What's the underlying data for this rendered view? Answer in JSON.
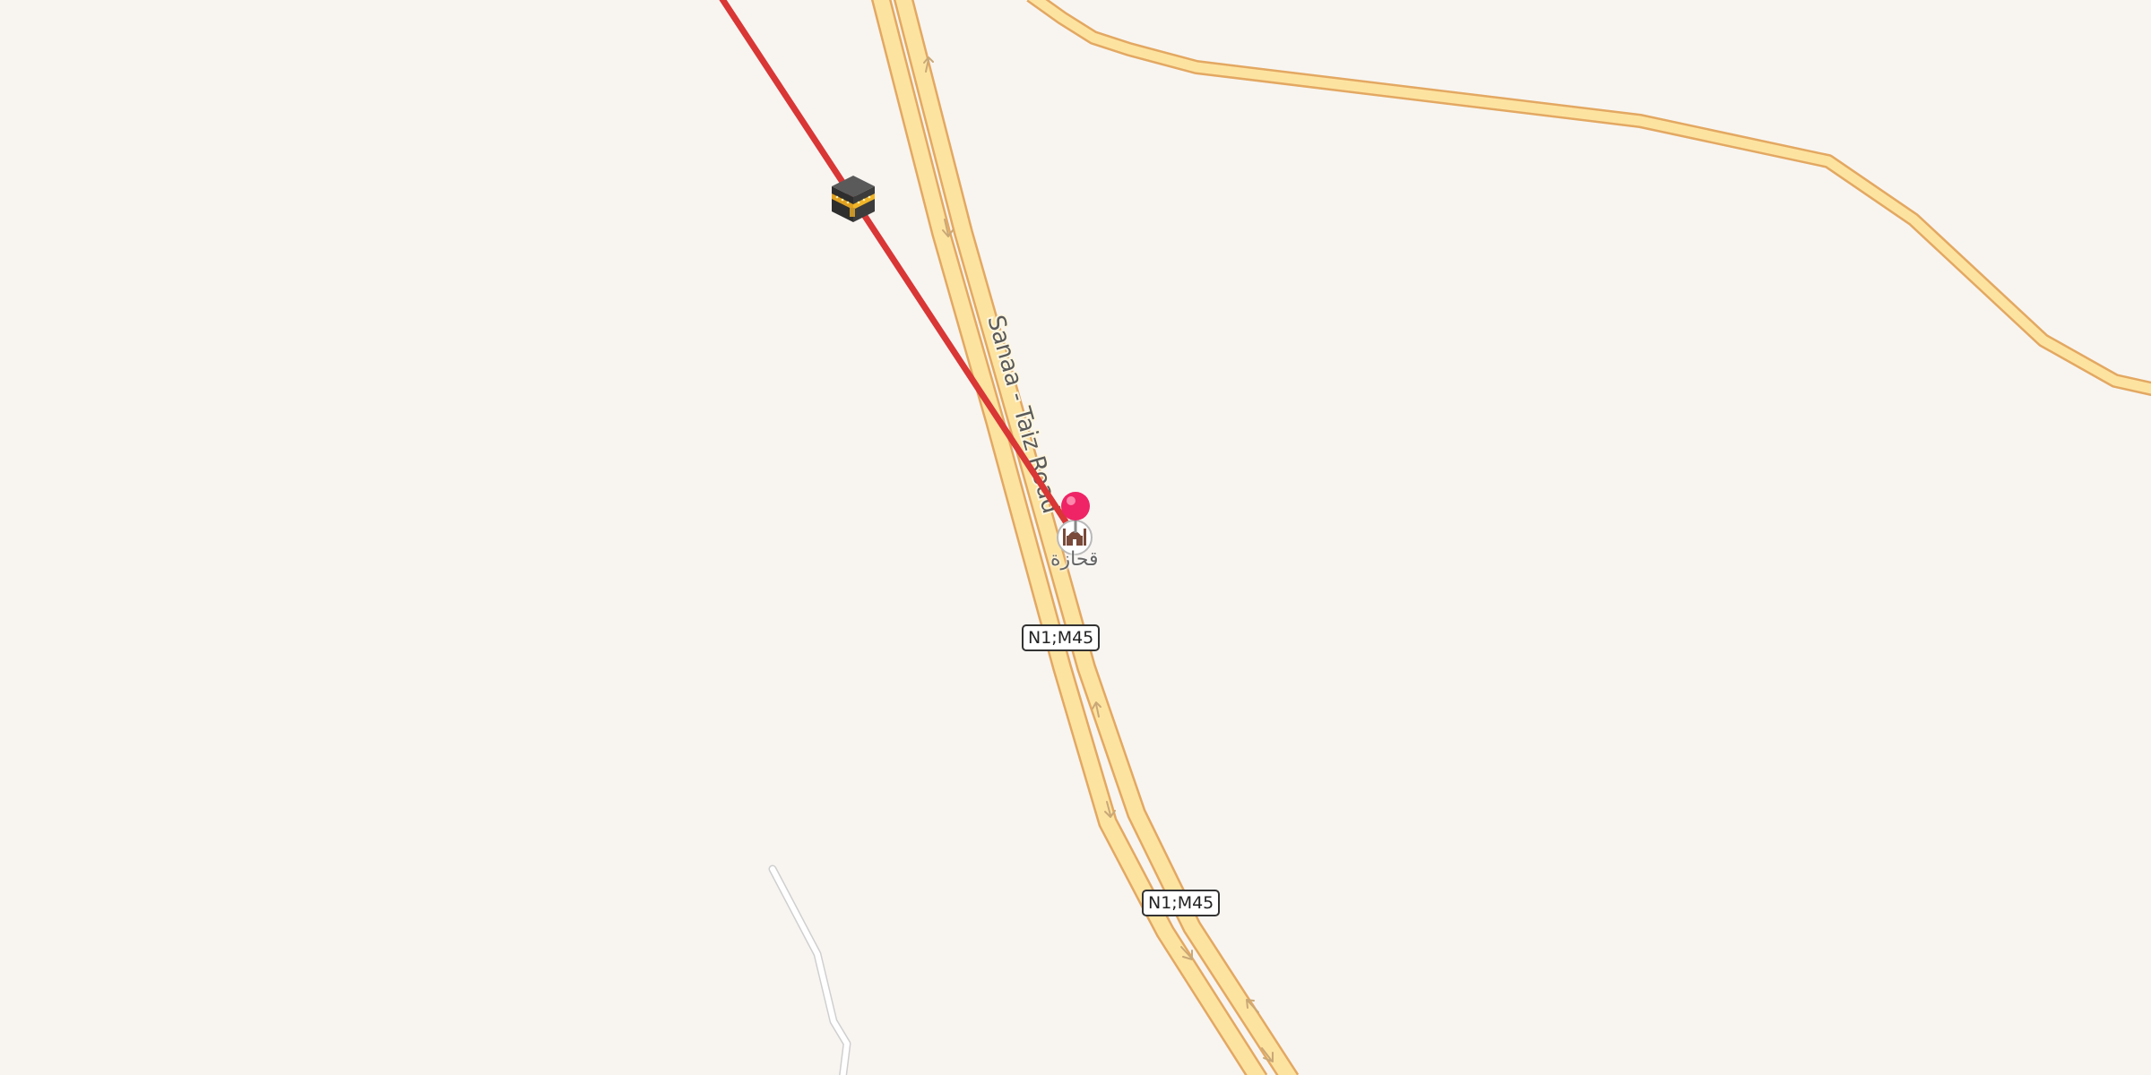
{
  "map": {
    "road_name": "Sanaa - Taiz Road",
    "road_ref": "N1;M45",
    "place_name": "قحازة",
    "qibla_icon": "kaaba-icon",
    "place_icon": "mosque-icon",
    "marker_icon": "map-pin-icon",
    "colors": {
      "background": "#f8f5f1",
      "road_fill": "#fde3a0",
      "road_casing": "#e3a862",
      "qibla_line": "#d93636",
      "marker": "#ee2466",
      "track": "#e8e8e8"
    }
  }
}
